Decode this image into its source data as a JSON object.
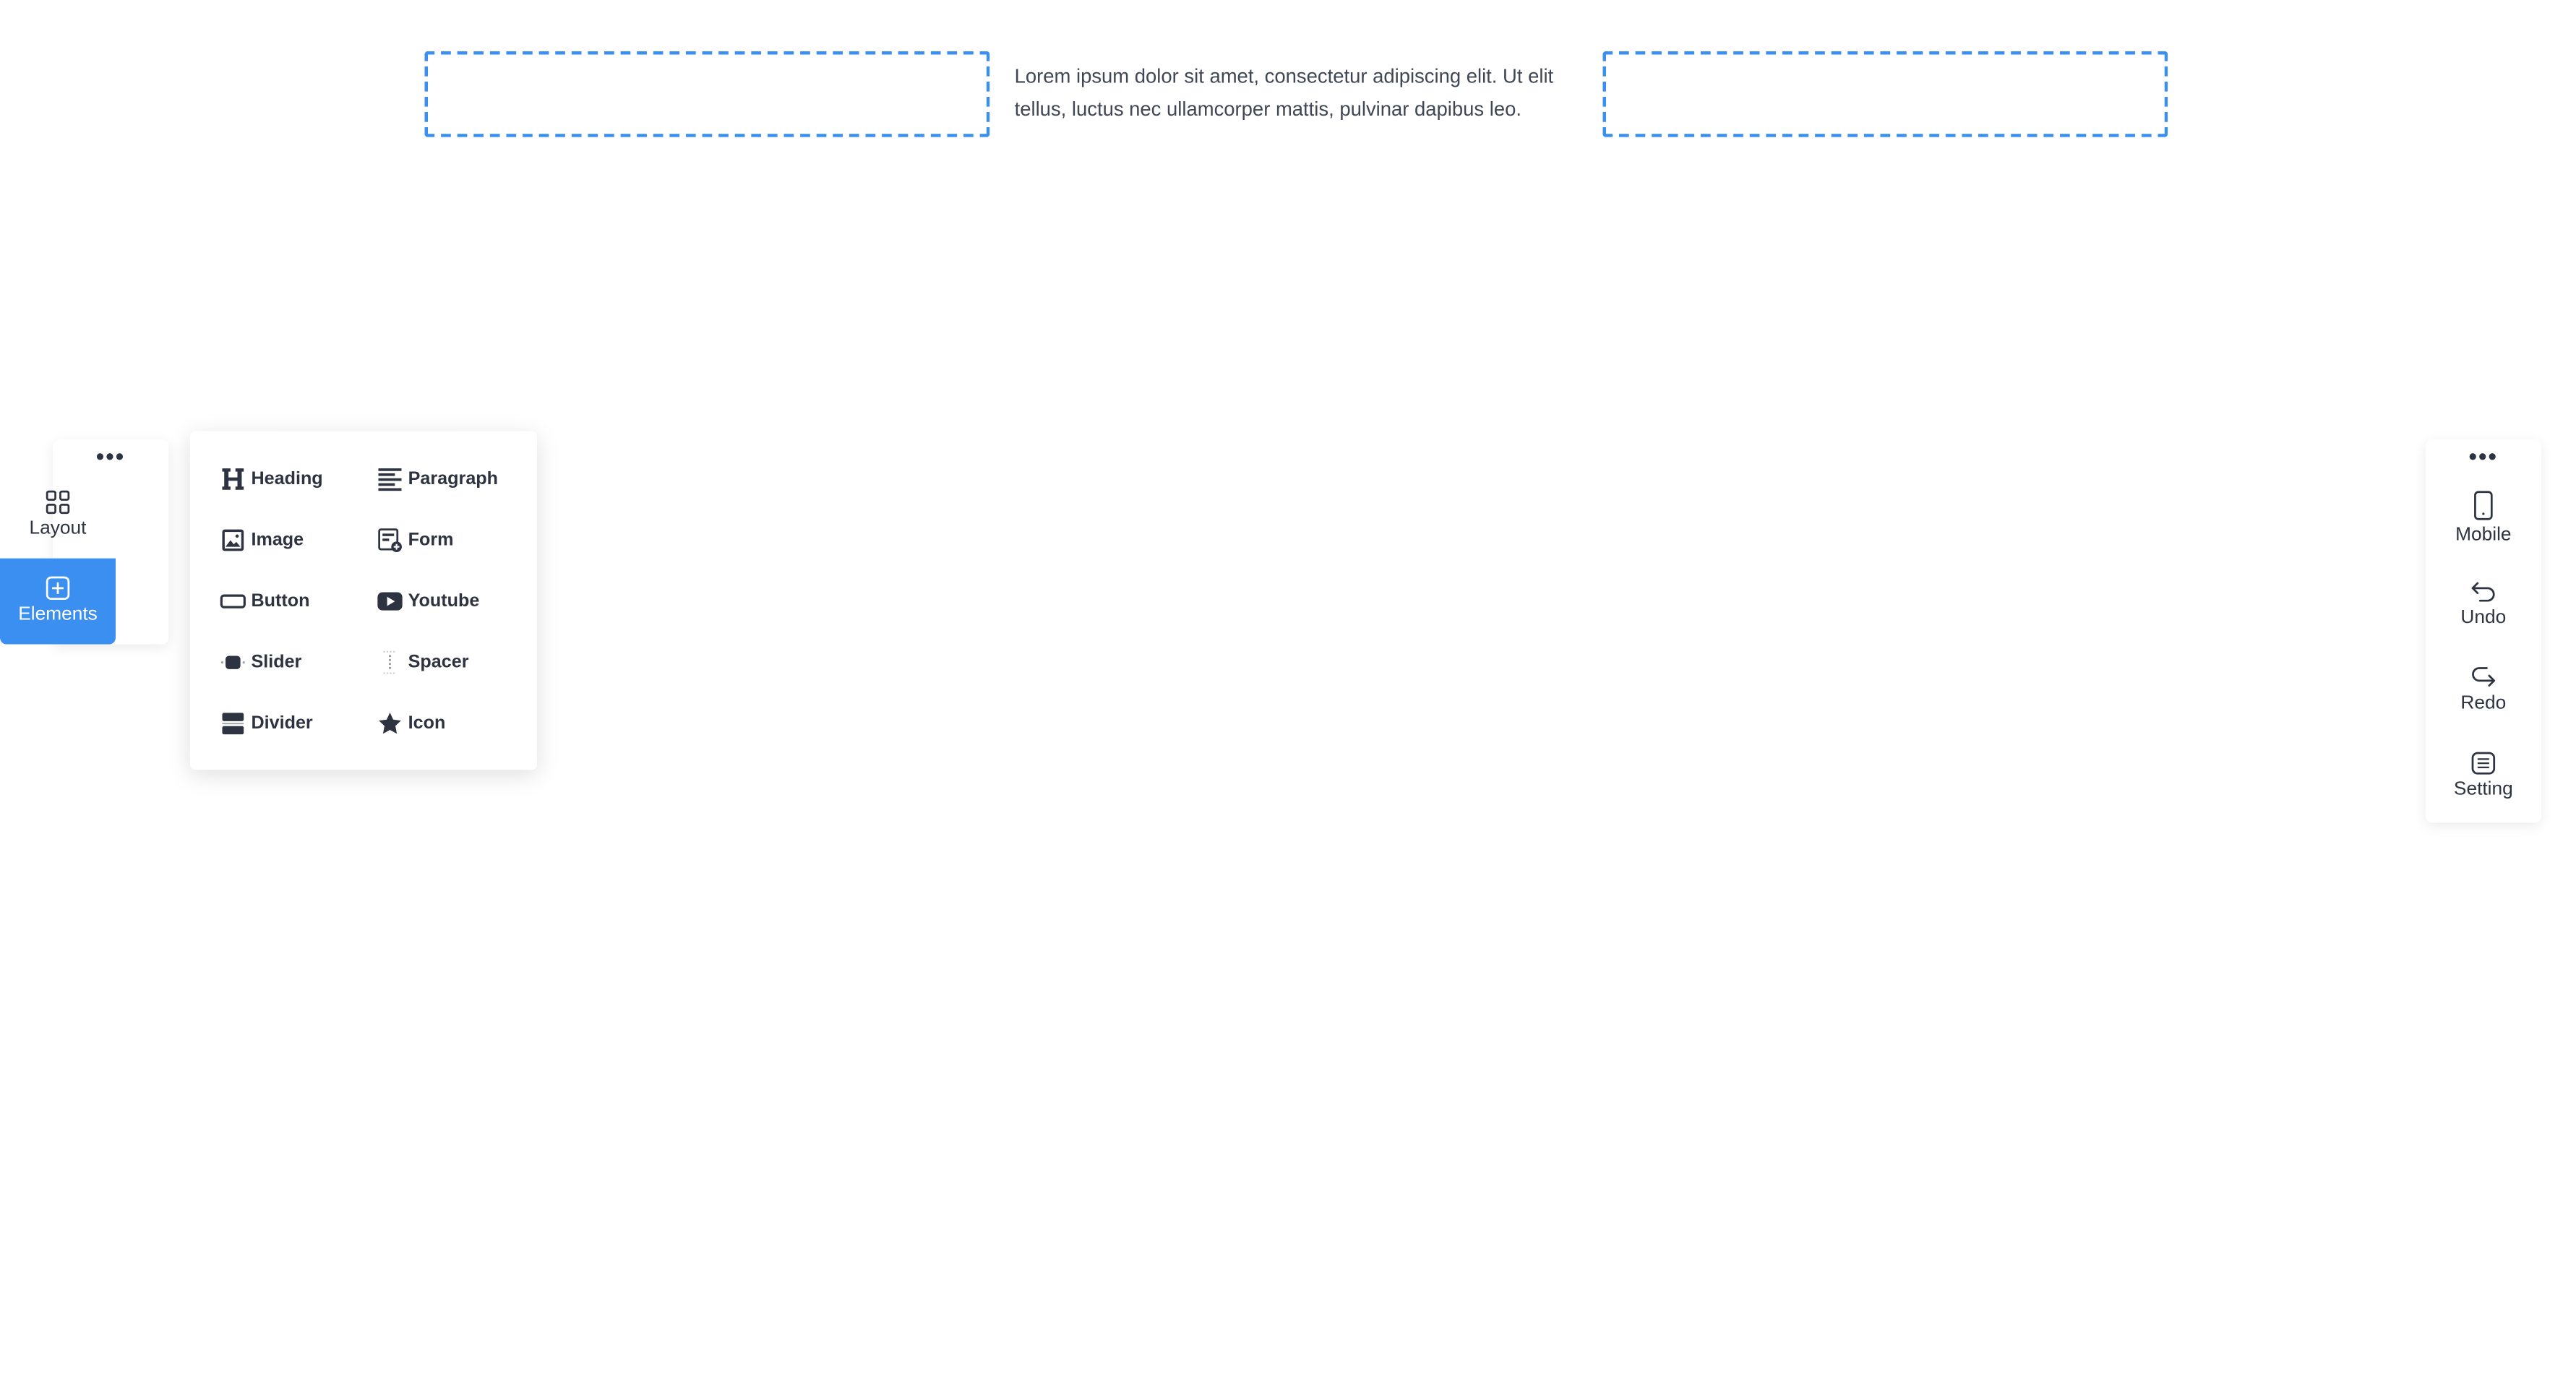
{
  "canvas": {
    "text_block": "Lorem ipsum dolor sit amet, consectetur adipiscing elit. Ut elit tellus, luctus nec ullamcorper mattis, pulvinar dapibus leo."
  },
  "left_bar": {
    "more": "•••",
    "layout_label": "Layout",
    "elements_label": "Elements"
  },
  "elements_panel": {
    "items": [
      {
        "label": "Heading",
        "icon": "heading-icon"
      },
      {
        "label": "Paragraph",
        "icon": "paragraph-icon"
      },
      {
        "label": "Image",
        "icon": "image-icon"
      },
      {
        "label": "Form",
        "icon": "form-icon"
      },
      {
        "label": "Button",
        "icon": "button-icon"
      },
      {
        "label": "Youtube",
        "icon": "youtube-icon"
      },
      {
        "label": "Slider",
        "icon": "slider-icon"
      },
      {
        "label": "Spacer",
        "icon": "spacer-icon"
      },
      {
        "label": "Divider",
        "icon": "divider-icon"
      },
      {
        "label": "Icon",
        "icon": "star-icon"
      }
    ]
  },
  "right_bar": {
    "more": "•••",
    "mobile_label": "Mobile",
    "undo_label": "Undo",
    "redo_label": "Redo",
    "setting_label": "Setting"
  },
  "colors": {
    "accent": "#3b8ff0",
    "text": "#2d3340"
  }
}
